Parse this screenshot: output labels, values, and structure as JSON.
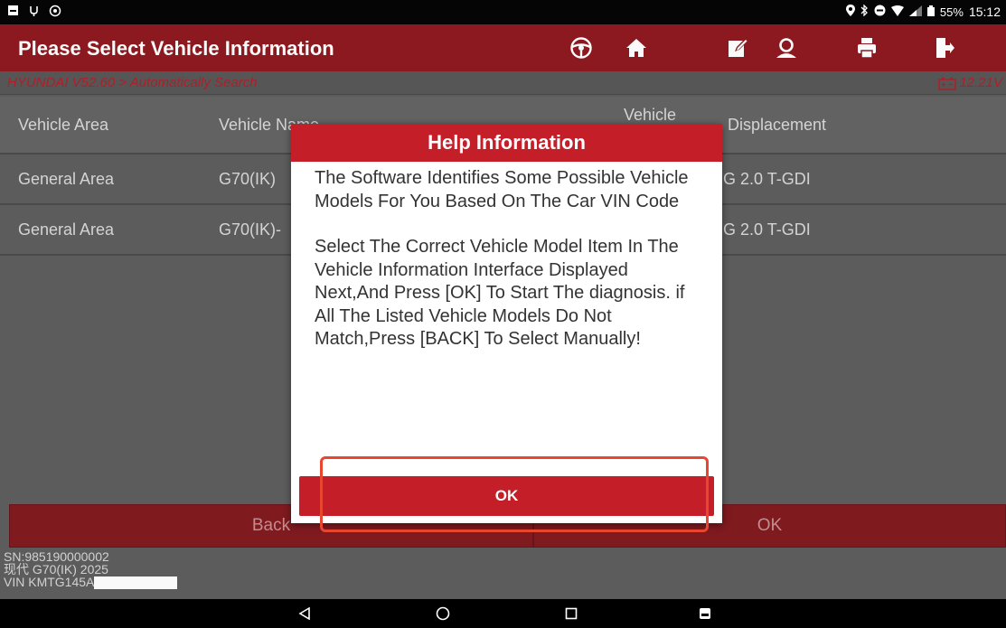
{
  "status_bar": {
    "left_icons": [
      "notification-icon",
      "usb-icon",
      "sync-icon"
    ],
    "battery_percent": "55%",
    "time": "15:12"
  },
  "titlebar": {
    "title": "Please Select Vehicle Information",
    "tools": [
      "steering-wheel-icon",
      "home-icon",
      "edit-icon",
      "user-icon",
      "print-icon",
      "exit-icon"
    ]
  },
  "breadcrumb": {
    "path": "HYUNDAI V52.60 > Automatically Search",
    "voltage": "12.21V"
  },
  "table": {
    "headers": [
      "Vehicle Area",
      "Vehicle Name",
      "Vehicle",
      "Displacement"
    ],
    "rows": [
      [
        "General Area",
        "G70(IK)",
        "G 2.0 T-GDI"
      ],
      [
        "General Area",
        "G70(IK)-",
        "G 2.0 T-GDI"
      ]
    ]
  },
  "bottom_buttons": {
    "back": "Back",
    "ok": "OK"
  },
  "info": {
    "sn": "SN:985190000002",
    "model": "现代 G70(IK) 2025",
    "vin": "VIN KMTG145A"
  },
  "dialog": {
    "title": "Help Information",
    "paragraph1": "The Software Identifies Some Possible Vehicle Models For You Based On The Car VIN Code",
    "paragraph2": "Select The Correct Vehicle Model Item In The Vehicle Information Interface Displayed Next,And Press [OK] To Start The diagnosis. if All The Listed Vehicle Models Do Not Match,Press [BACK] To Select Manually!",
    "ok_label": "OK"
  },
  "colors": {
    "brand_red": "#c41e29",
    "title_red": "#8e1a20",
    "highlight": "#e8462e"
  }
}
